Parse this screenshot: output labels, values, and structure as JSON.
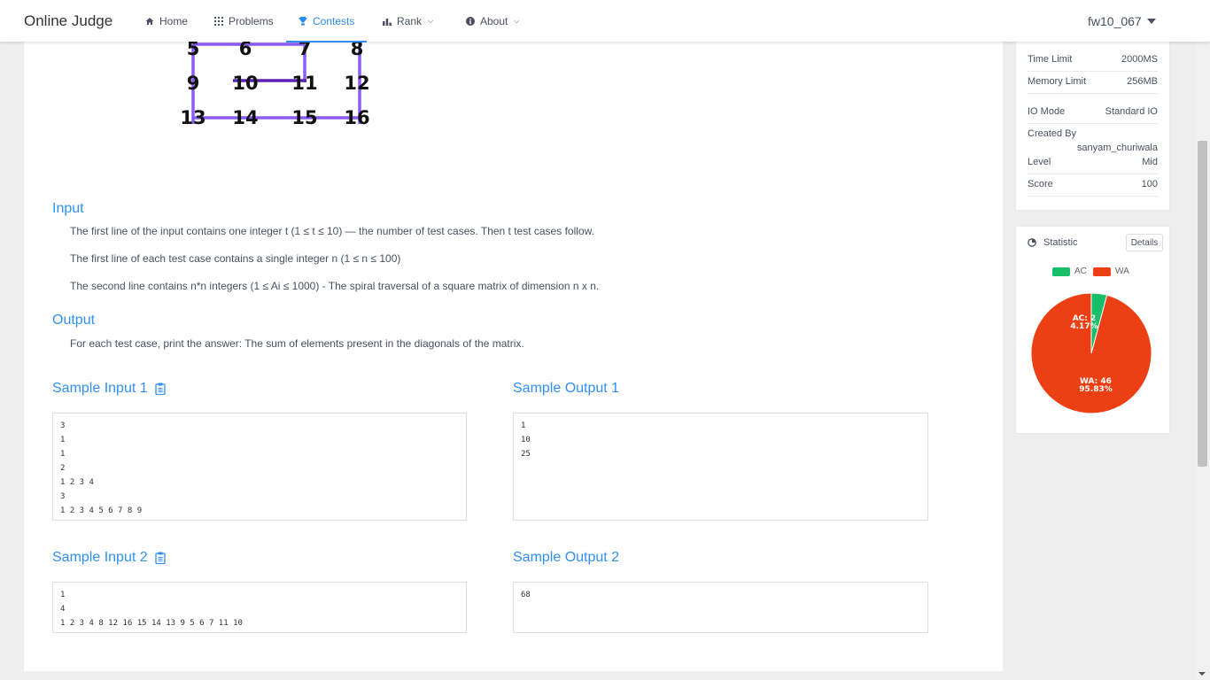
{
  "header": {
    "brand": "Online Judge",
    "nav": [
      {
        "label": "Home",
        "icon": "home-icon"
      },
      {
        "label": "Problems",
        "icon": "grid-icon"
      },
      {
        "label": "Contests",
        "icon": "trophy-icon"
      },
      {
        "label": "Rank",
        "icon": "bar-chart-icon"
      },
      {
        "label": "About",
        "icon": "info-icon"
      }
    ],
    "active_nav": "Contests",
    "user": "fw10_067",
    "accent_color": "#2d8cf0"
  },
  "figure": {
    "numbers": [
      "5",
      "6",
      "7",
      "8",
      "9",
      "10",
      "11",
      "12",
      "13",
      "14",
      "15",
      "16"
    ],
    "line_color": "#8b5cf6"
  },
  "problem": {
    "input_title": "Input",
    "input_lines": [
      "The first line of the input contains one integer t (1 ≤ t ≤ 10) — the number of test cases. Then t test cases follow.",
      "The first line of each test case contains a single integer n (1 ≤ n ≤ 100)",
      "The second line contains n*n integers (1 ≤ Ai ≤ 1000) - The spiral traversal of a square matrix of dimension n x n."
    ],
    "output_title": "Output",
    "output_lines": [
      "For each test case, print the answer: The sum of elements present in the diagonals of the matrix."
    ]
  },
  "samples": [
    {
      "input_title": "Sample Input 1",
      "output_title": "Sample Output 1",
      "input": "3\n1\n1\n2\n1 2 3 4\n3\n1 2 3 4 5 6 7 8 9",
      "output": "1\n10\n25"
    },
    {
      "input_title": "Sample Input 2",
      "output_title": "Sample Output 2",
      "input": "1\n4\n1 2 3 4 8 12 16 15 14 13 9 5 6 7 11 10",
      "output": "68"
    }
  ],
  "info": {
    "time_limit_label": "Time Limit",
    "time_limit": "2000MS",
    "memory_limit_label": "Memory Limit",
    "memory_limit": "256MB",
    "io_mode_label": "IO Mode",
    "io_mode": "Standard IO",
    "created_by_label": "Created By",
    "created_by": "sanyam_churiwala",
    "level_label": "Level",
    "level": "Mid",
    "score_label": "Score",
    "score": "100"
  },
  "statistic": {
    "title": "Statistic",
    "details_label": "Details",
    "legend": [
      {
        "label": "AC",
        "color": "#19be6b"
      },
      {
        "label": "WA",
        "color": "#ed3f14"
      }
    ],
    "ac_label": "AC: 2",
    "ac_percent": "4.17%",
    "wa_label": "WA: 46",
    "wa_percent": "95.83%",
    "ac_count": 2,
    "wa_count": 46
  }
}
